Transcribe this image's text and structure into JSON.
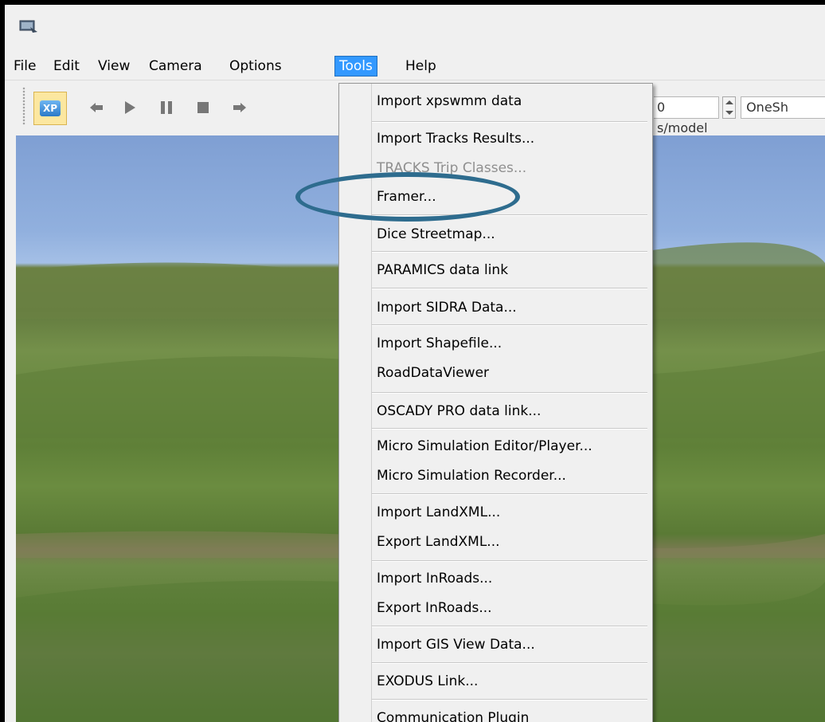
{
  "menubar": {
    "items": [
      {
        "label": "File"
      },
      {
        "label": "Edit"
      },
      {
        "label": "View"
      },
      {
        "label": "Camera"
      },
      {
        "label": "Options"
      },
      {
        "label": "Tools"
      },
      {
        "label": "Help"
      }
    ],
    "active": "Tools"
  },
  "toolbar": {
    "xp_label": "XP",
    "model_rate": "0 s/model",
    "mode": "OneSh"
  },
  "tools_menu": {
    "items": [
      {
        "label": "Import xpswmm data",
        "enabled": true
      },
      {
        "label": "Import Tracks Results...",
        "enabled": true
      },
      {
        "label": "TRACKS Trip Classes...",
        "enabled": false
      },
      {
        "label": "Framer...",
        "enabled": true,
        "highlighted": true
      },
      {
        "label": "Dice Streetmap...",
        "enabled": true
      },
      {
        "label": "PARAMICS data link",
        "enabled": true
      },
      {
        "label": "Import SIDRA Data...",
        "enabled": true
      },
      {
        "label": "Import Shapefile...",
        "enabled": true
      },
      {
        "label": "RoadDataViewer",
        "enabled": true
      },
      {
        "label": "OSCADY PRO data link...",
        "enabled": true
      },
      {
        "label": "Micro Simulation Editor/Player...",
        "enabled": true
      },
      {
        "label": "Micro Simulation Recorder...",
        "enabled": true
      },
      {
        "label": "Import LandXML...",
        "enabled": true
      },
      {
        "label": "Export LandXML...",
        "enabled": true
      },
      {
        "label": "Import InRoads...",
        "enabled": true
      },
      {
        "label": "Export InRoads...",
        "enabled": true
      },
      {
        "label": "Import GIS View Data...",
        "enabled": true
      },
      {
        "label": "EXODUS Link...",
        "enabled": true
      },
      {
        "label": "Communication Plugin",
        "enabled": true
      }
    ]
  },
  "annotation": {
    "color": "#2e6c8e"
  }
}
